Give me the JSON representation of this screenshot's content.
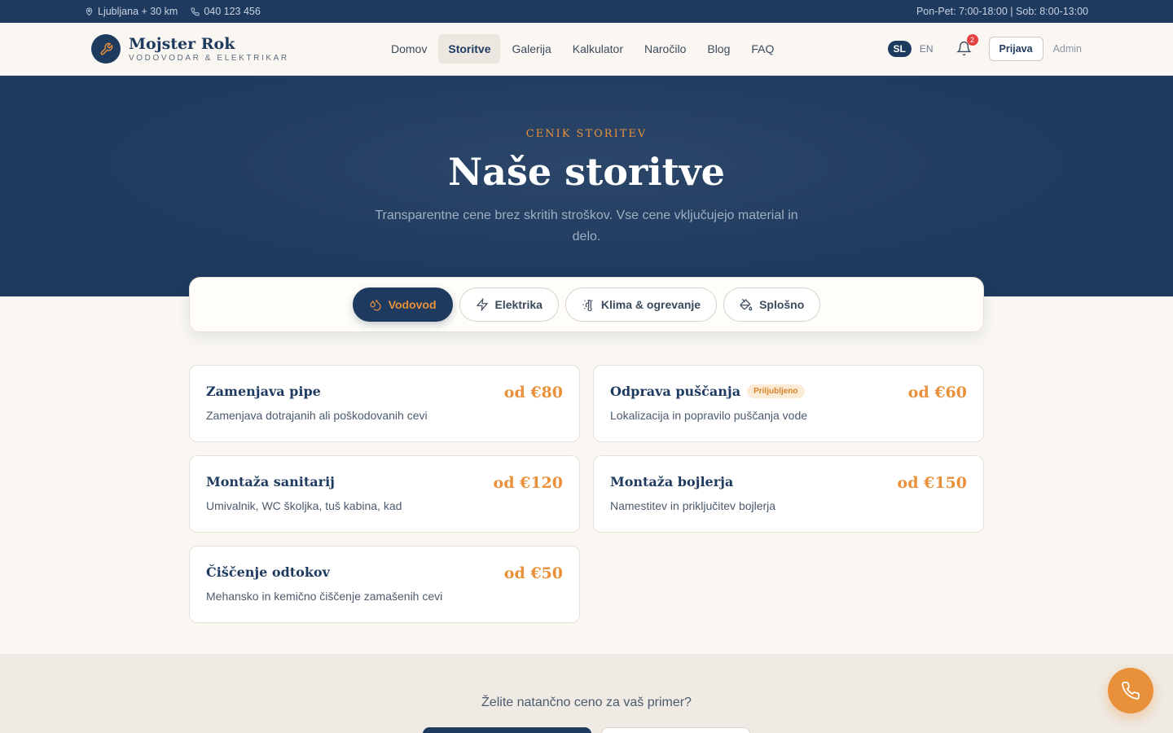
{
  "topbar": {
    "location": "Ljubljana + 30 km",
    "phone": "040 123 456",
    "hours": "Pon-Pet: 7:00-18:00 | Sob: 8:00-13:00"
  },
  "brand": {
    "name": "Mojster Rok",
    "tagline": "VODOVODAR & ELEKTRIKAR",
    "logo_icon": "wrench-icon"
  },
  "nav": {
    "items": [
      "Domov",
      "Storitve",
      "Galerija",
      "Kalkulator",
      "Naročilo",
      "Blog",
      "FAQ"
    ],
    "active": "Storitve"
  },
  "header_right": {
    "lang_active": "SL",
    "lang_other": "EN",
    "notification_count": "2",
    "login_label": "Prijava",
    "admin_label": "Admin"
  },
  "hero": {
    "eyebrow": "CENIK STORITEV",
    "title": "Naše storitve",
    "subtitle": "Transparentne cene brez skritih stroškov. Vse cene vključujejo material in delo."
  },
  "tabs": [
    {
      "label": "Vodovod",
      "icon": "droplets-icon",
      "active": true
    },
    {
      "label": "Elektrika",
      "icon": "zap-icon",
      "active": false
    },
    {
      "label": "Klima & ogrevanje",
      "icon": "thermometer-sun-icon",
      "active": false
    },
    {
      "label": "Splošno",
      "icon": "paint-bucket-icon",
      "active": false
    }
  ],
  "services": [
    {
      "title": "Zamenjava pipe",
      "desc": "Zamenjava dotrajanih ali poškodovanih cevi",
      "price": "od €80",
      "badge": ""
    },
    {
      "title": "Odprava puščanja",
      "desc": "Lokalizacija in popravilo puščanja vode",
      "price": "od €60",
      "badge": "Priljubljeno"
    },
    {
      "title": "Montaža sanitarij",
      "desc": "Umivalnik, WC školjka, tuš kabina, kad",
      "price": "od €120",
      "badge": ""
    },
    {
      "title": "Montaža bojlerja",
      "desc": "Namestitev in priključitev bojlerja",
      "price": "od €150",
      "badge": ""
    },
    {
      "title": "Čiščenje odtokov",
      "desc": "Mehansko in kemično čiščenje zamašenih cevi",
      "price": "od €50",
      "badge": ""
    }
  ],
  "cta": {
    "question": "Želite natančno ceno za vaš primer?"
  },
  "colors": {
    "navy": "#1e3a5f",
    "accent": "#e8913a",
    "background": "#faf7f2"
  }
}
